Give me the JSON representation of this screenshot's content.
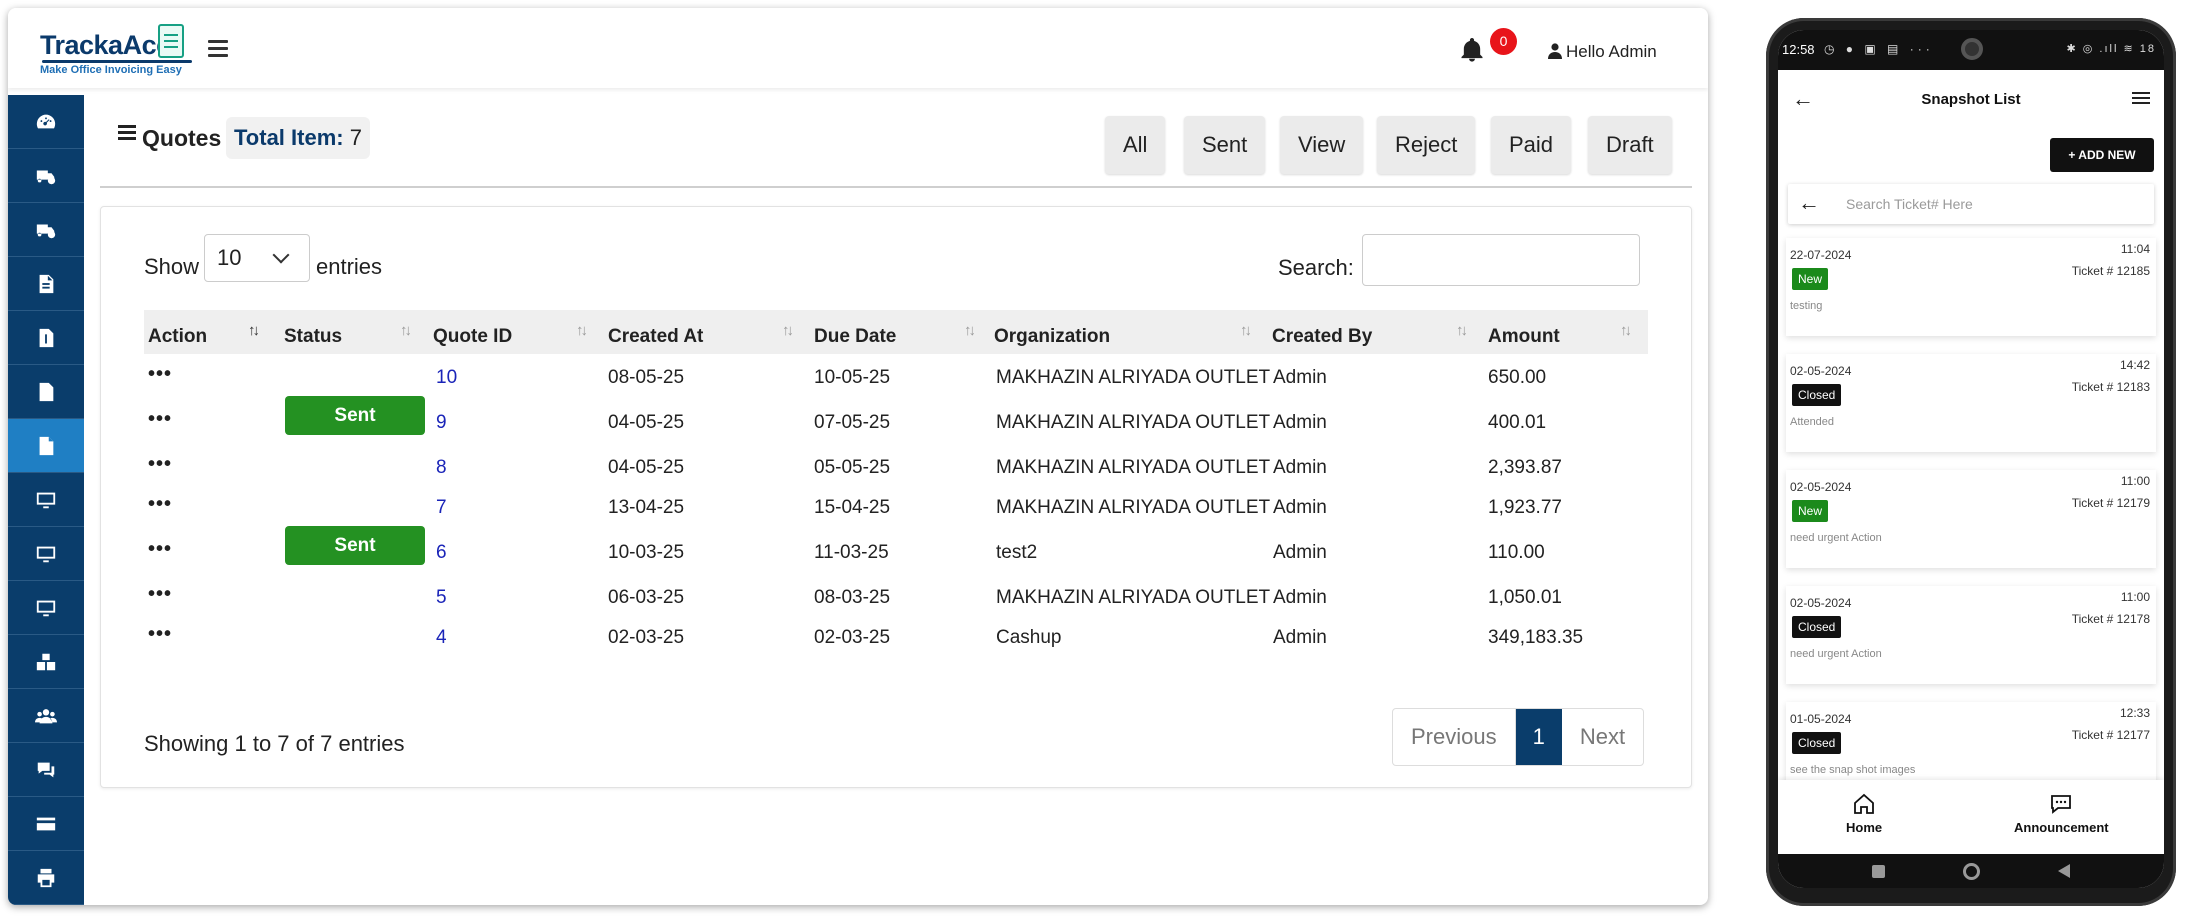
{
  "app": {
    "logo_text": "TrackaAcc",
    "logo_tagline": "Make Office Invoicing Easy",
    "notification_count": "0",
    "user_greeting": "Hello Admin"
  },
  "sidebar": {
    "items": [
      {
        "icon": "dashboard-icon"
      },
      {
        "icon": "truck-clock-icon"
      },
      {
        "icon": "truck-settings-icon"
      },
      {
        "icon": "invoice-doc-icon"
      },
      {
        "icon": "receipt-doc-icon"
      },
      {
        "icon": "document-icon"
      },
      {
        "icon": "quote-doc-icon",
        "active": true
      },
      {
        "icon": "monitor-icon"
      },
      {
        "icon": "monitor-icon"
      },
      {
        "icon": "monitor-icon"
      },
      {
        "icon": "boxes-icon"
      },
      {
        "icon": "users-icon"
      },
      {
        "icon": "support-icon"
      },
      {
        "icon": "credit-card-icon"
      },
      {
        "icon": "printer-icon"
      }
    ],
    "active_color": "#1f7fc4",
    "bg_color": "#0a3d6b"
  },
  "page": {
    "title": "Quotes",
    "total_label": "Total Item:",
    "total_value": "7",
    "filters": [
      "All",
      "Sent",
      "View",
      "Reject",
      "Paid",
      "Draft"
    ]
  },
  "table_controls": {
    "show_label": "Show",
    "page_size": "10",
    "entries_label": "entries",
    "search_label": "Search:"
  },
  "table": {
    "headers": [
      "Action",
      "Status",
      "Quote ID",
      "Created At",
      "Due Date",
      "Organization",
      "Created By",
      "Amount"
    ],
    "rows": [
      {
        "action": "•••",
        "status": "",
        "id": "10",
        "created": "08-05-25",
        "due": "10-05-25",
        "org": "MAKHAZIN ALRIYADA OUTLET",
        "by": "Admin",
        "amount": "650.00"
      },
      {
        "action": "•••",
        "status": "Sent",
        "id": "9",
        "created": "04-05-25",
        "due": "07-05-25",
        "org": "MAKHAZIN ALRIYADA OUTLET",
        "by": "Admin",
        "amount": "400.01"
      },
      {
        "action": "•••",
        "status": "",
        "id": "8",
        "created": "04-05-25",
        "due": "05-05-25",
        "org": "MAKHAZIN ALRIYADA OUTLET",
        "by": "Admin",
        "amount": "2,393.87"
      },
      {
        "action": "•••",
        "status": "",
        "id": "7",
        "created": "13-04-25",
        "due": "15-04-25",
        "org": "MAKHAZIN ALRIYADA OUTLET",
        "by": "Admin",
        "amount": "1,923.77"
      },
      {
        "action": "•••",
        "status": "Sent",
        "id": "6",
        "created": "10-03-25",
        "due": "11-03-25",
        "org": "test2",
        "by": "Admin",
        "amount": "110.00"
      },
      {
        "action": "•••",
        "status": "",
        "id": "5",
        "created": "06-03-25",
        "due": "08-03-25",
        "org": "MAKHAZIN ALRIYADA OUTLET",
        "by": "Admin",
        "amount": "1,050.01"
      },
      {
        "action": "•••",
        "status": "",
        "id": "4",
        "created": "02-03-25",
        "due": "02-03-25",
        "org": "Cashup",
        "by": "Admin",
        "amount": "349,183.35"
      }
    ],
    "status_color": "#249122"
  },
  "footer": {
    "showing": "Showing 1 to 7 of 7 entries",
    "prev": "Previous",
    "current_page": "1",
    "next": "Next"
  },
  "phone": {
    "status_time": "12:58",
    "status_icons_left": "◷ ● ▣ ▤ ···",
    "status_icons_right": "✱ ◎ .ıll ≋ 18",
    "title": "Snapshot List",
    "add_button": "+ ADD NEW",
    "search_placeholder": "Search Ticket# Here",
    "tickets": [
      {
        "date": "22-07-2024",
        "time": "11:04",
        "ticket": "Ticket # 12185",
        "status": "New",
        "note": "testing"
      },
      {
        "date": "02-05-2024",
        "time": "14:42",
        "ticket": "Ticket # 12183",
        "status": "Closed",
        "note": "Attended"
      },
      {
        "date": "02-05-2024",
        "time": "11:00",
        "ticket": "Ticket # 12179",
        "status": "New",
        "note": "need urgent Action"
      },
      {
        "date": "02-05-2024",
        "time": "11:00",
        "ticket": "Ticket # 12178",
        "status": "Closed",
        "note": "need urgent Action"
      },
      {
        "date": "01-05-2024",
        "time": "12:33",
        "ticket": "Ticket # 12177",
        "status": "Closed",
        "note": "see the snap shot images"
      }
    ],
    "nav": [
      "Home",
      "Announcement"
    ]
  }
}
